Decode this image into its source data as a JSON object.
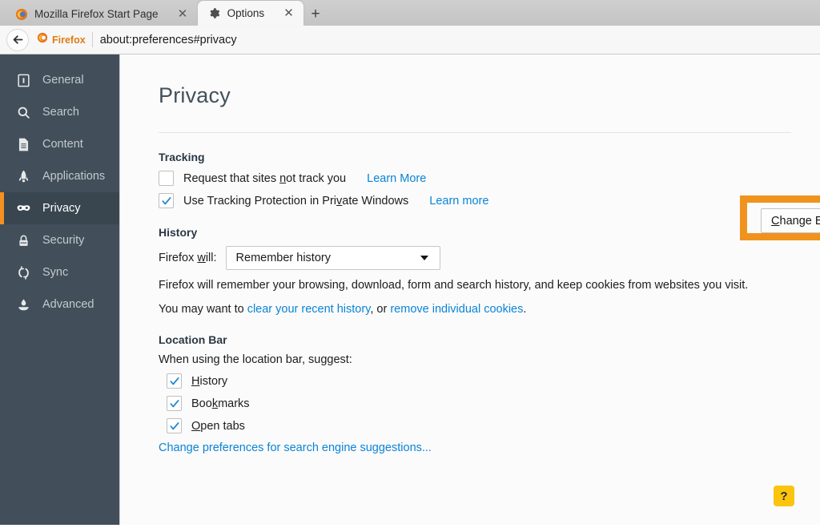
{
  "browser": {
    "tabs": [
      {
        "title": "Mozilla Firefox Start Page",
        "icon": "firefox-logo-icon",
        "active": false
      },
      {
        "title": "Options",
        "icon": "gear-icon",
        "active": true
      }
    ],
    "new_tab_label": "+",
    "close_label": "✕",
    "back_label": "←",
    "identity_label": "Firefox",
    "url": "about:preferences#privacy"
  },
  "sidebar": {
    "items": [
      {
        "label": "General",
        "icon": "general-icon"
      },
      {
        "label": "Search",
        "icon": "search-icon"
      },
      {
        "label": "Content",
        "icon": "content-icon"
      },
      {
        "label": "Applications",
        "icon": "rocket-icon"
      },
      {
        "label": "Privacy",
        "icon": "mask-icon"
      },
      {
        "label": "Security",
        "icon": "lock-icon"
      },
      {
        "label": "Sync",
        "icon": "sync-icon"
      },
      {
        "label": "Advanced",
        "icon": "flask-icon"
      }
    ],
    "selected": "Privacy",
    "accent_color": "#f59120",
    "background_color": "#424f5a"
  },
  "page": {
    "title": "Privacy"
  },
  "tracking": {
    "heading": "Tracking",
    "dnt": {
      "label_before": "Request that sites ",
      "label_key": "n",
      "label_after": "ot track you",
      "checked": false,
      "link": "Learn More"
    },
    "protection": {
      "label_before": "Use Tracking Protection in Pri",
      "label_key": "v",
      "label_after": "ate Windows",
      "checked": true,
      "link": "Learn more"
    },
    "block_list_button": {
      "key": "C",
      "rest": "hange Block List",
      "highlighted": true,
      "highlight_color": "#f0931e"
    }
  },
  "history": {
    "heading": "History",
    "label_before": "Firefox ",
    "label_key": "w",
    "label_after": "ill:",
    "selected_option": "Remember history",
    "description": "Firefox will remember your browsing, download, form and search history, and keep cookies from websites you visit.",
    "footer_prefix": "You may want to ",
    "footer_link1": "clear your recent history",
    "footer_middle": ", or ",
    "footer_link2": "remove individual cookies",
    "footer_suffix": "."
  },
  "location_bar": {
    "heading": "Location Bar",
    "lead": "When using the location bar, suggest:",
    "options": [
      {
        "key": "H",
        "rest": "istory",
        "prefix": "",
        "checked": true
      },
      {
        "key": "k",
        "rest": "marks",
        "prefix": "Boo",
        "checked": true
      },
      {
        "key": "O",
        "rest": "pen tabs",
        "prefix": "",
        "checked": true
      }
    ],
    "link": "Change preferences for search engine suggestions..."
  },
  "help": {
    "label": "?",
    "color": "#fbc40f"
  }
}
